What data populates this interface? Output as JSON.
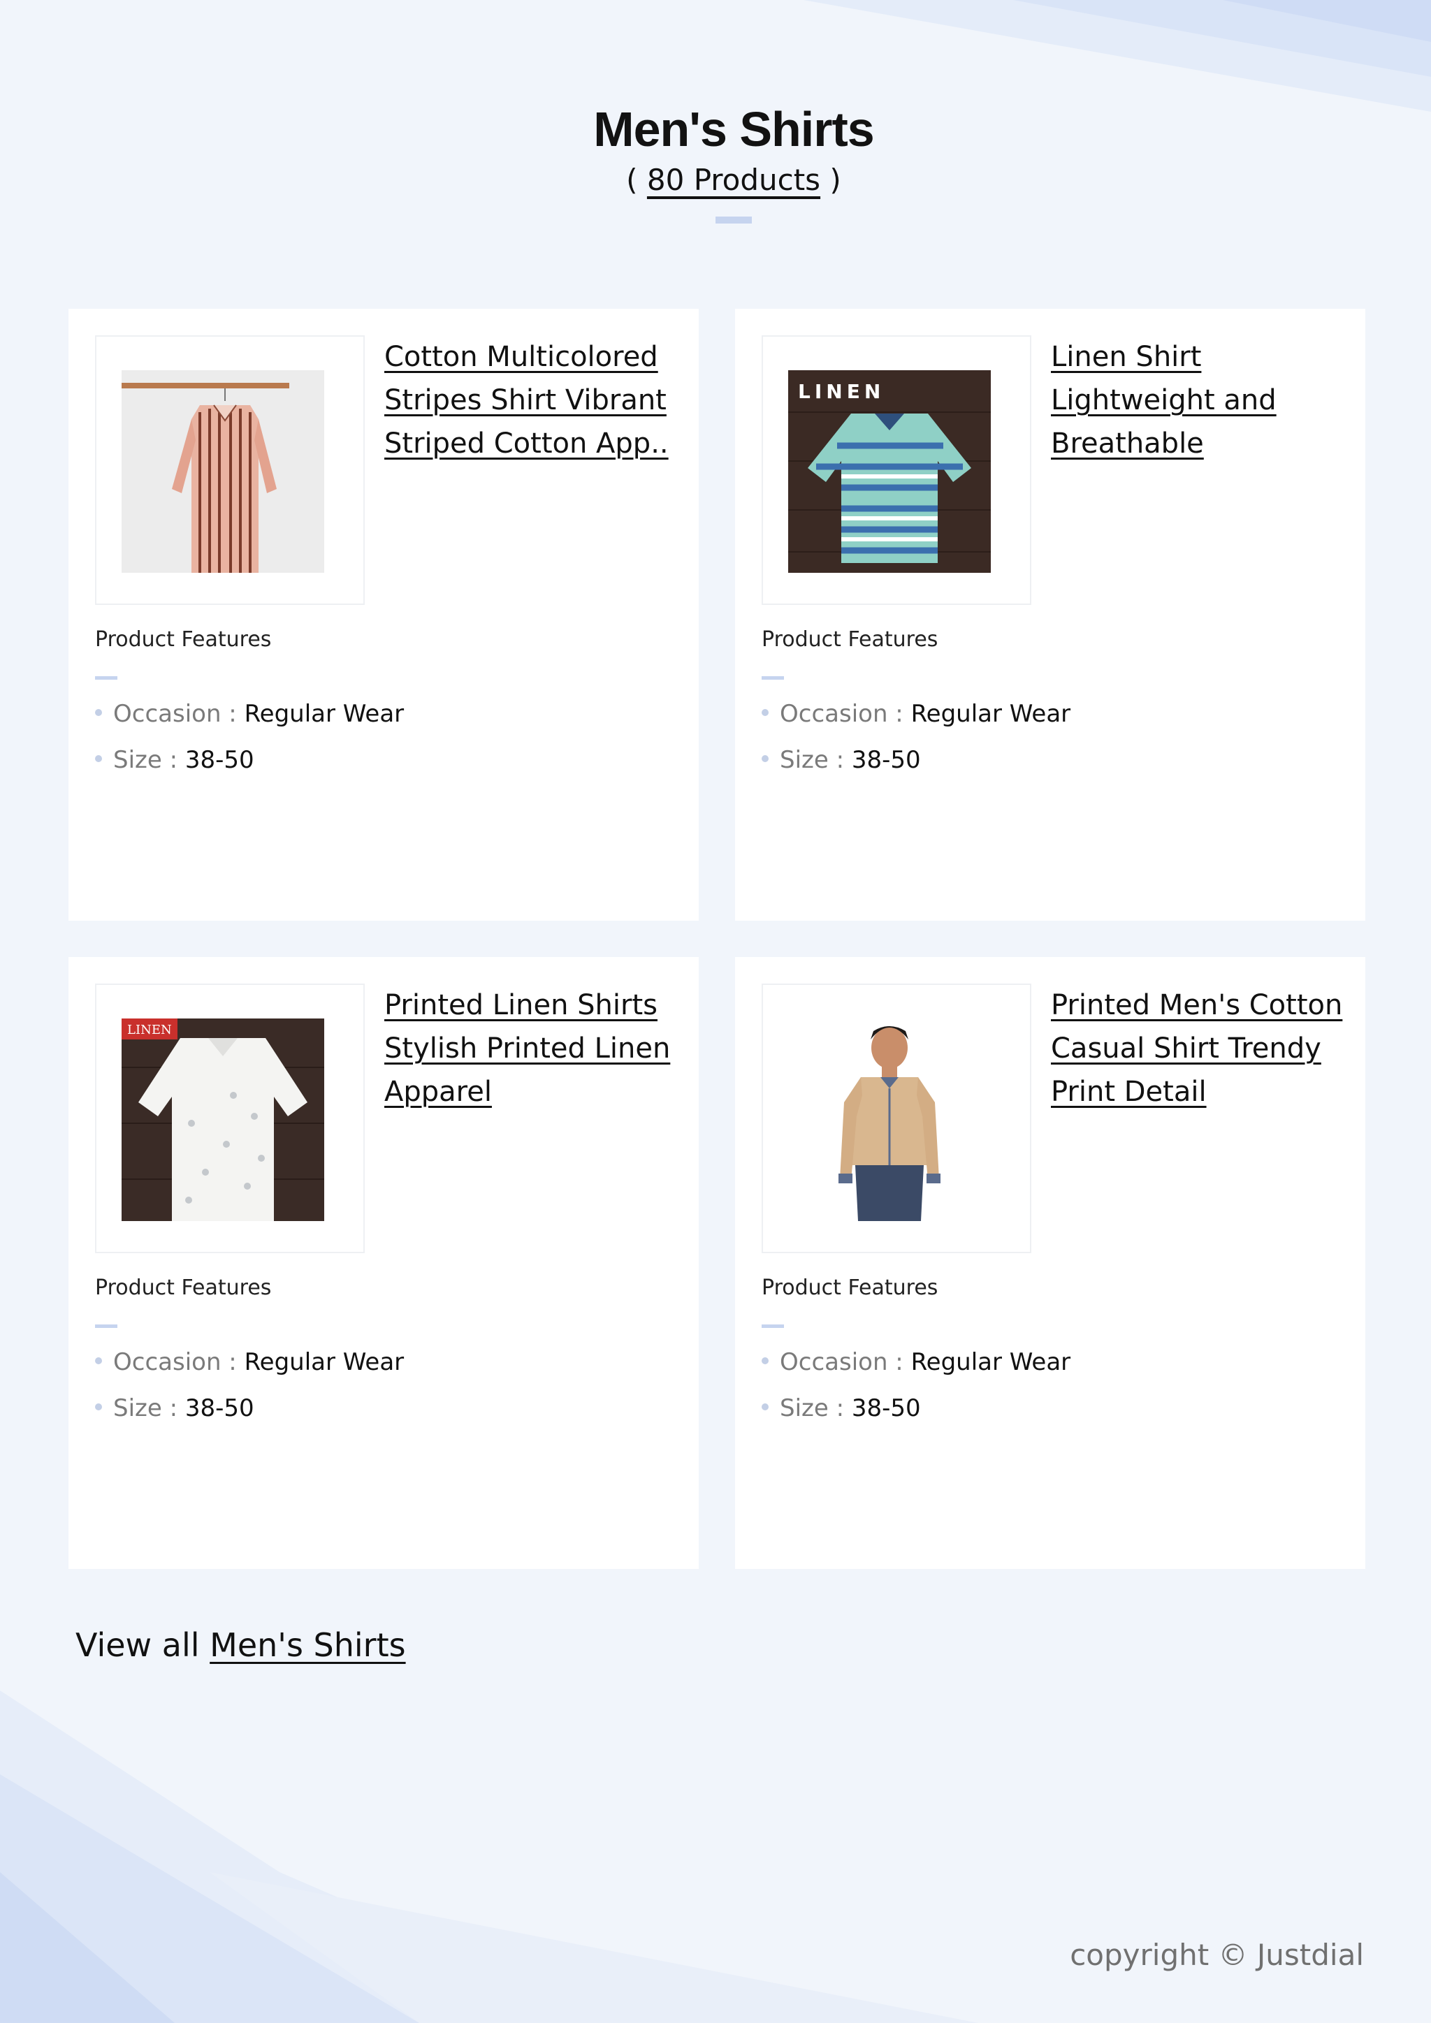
{
  "page": {
    "title": "Men's Shirts",
    "count_open": "( ",
    "count_link": "80 Products",
    "count_close": " )"
  },
  "products": [
    {
      "title": "Cotton Multicolored Stripes Shirt Vibrant Striped Cotton App..",
      "features_label": "Product Features",
      "occasion_key": "Occasion : ",
      "occasion": "Regular Wear",
      "size_key": "Size : ",
      "size": "38-50",
      "image": "striped-shirt-on-hanger"
    },
    {
      "title": "Linen Shirt Lightweight and Breathable",
      "features_label": "Product Features",
      "occasion_key": "Occasion : ",
      "occasion": "Regular Wear",
      "size_key": "Size : ",
      "size": "38-50",
      "image": "teal-striped-linen-shirt",
      "image_text": "LINEN"
    },
    {
      "title": "Printed Linen Shirts Stylish Printed Linen Apparel",
      "features_label": "Product Features",
      "occasion_key": "Occasion : ",
      "occasion": "Regular Wear",
      "size_key": "Size : ",
      "size": "38-50",
      "image": "white-printed-linen-shirt",
      "image_text": "LINEN"
    },
    {
      "title": "Printed Men's Cotton Casual Shirt Trendy Print Detail",
      "features_label": "Product Features",
      "occasion_key": "Occasion : ",
      "occasion": "Regular Wear",
      "size_key": "Size : ",
      "size": "38-50",
      "image": "man-in-beige-shirt"
    }
  ],
  "footer": {
    "view_all_prefix": "View all ",
    "view_all_link": "Men's Shirts",
    "copyright": "copyright © Justdial"
  },
  "colors": {
    "background": "#f1f5fb",
    "accent": "#c6d4ef",
    "card": "#ffffff"
  }
}
